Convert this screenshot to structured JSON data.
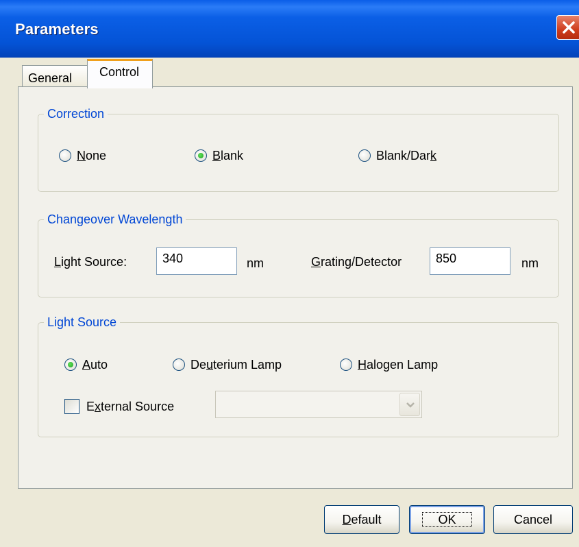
{
  "window": {
    "title": "Parameters"
  },
  "tabs": [
    {
      "label": "General",
      "selected": false
    },
    {
      "label": "Control",
      "selected": true
    }
  ],
  "correction": {
    "legend": "Correction",
    "options": [
      {
        "label": "None",
        "accel": "N",
        "rest": "one",
        "checked": false
      },
      {
        "label": "Blank",
        "accel": "B",
        "rest": "lank",
        "checked": true
      },
      {
        "pre": "Blank/Dar",
        "accel": "k",
        "label": "Blank/Dark",
        "checked": false
      }
    ]
  },
  "wavelength": {
    "legend": "Changeover Wavelength",
    "light_source_accel": "L",
    "light_source_rest": "ight Source:",
    "light_source_value": "340",
    "unit": "nm",
    "grating_accel": "G",
    "grating_rest": "rating/Detector",
    "grating_value": "850"
  },
  "light_source": {
    "legend": "Light Source",
    "options": [
      {
        "label": "Auto",
        "accel": "A",
        "rest": "uto",
        "checked": true
      },
      {
        "label": "Deuterium Lamp",
        "pre": "De",
        "accel": "u",
        "rest": "terium Lamp",
        "checked": false
      },
      {
        "label": "Halogen Lamp",
        "accel": "H",
        "rest": "alogen Lamp",
        "checked": false
      }
    ],
    "external_pre": "E",
    "external_accel": "x",
    "external_rest": "ternal Source",
    "external_checked": false,
    "external_value": ""
  },
  "buttons": {
    "default_accel": "D",
    "default_rest": "efault",
    "ok": "OK",
    "cancel": "Cancel"
  }
}
